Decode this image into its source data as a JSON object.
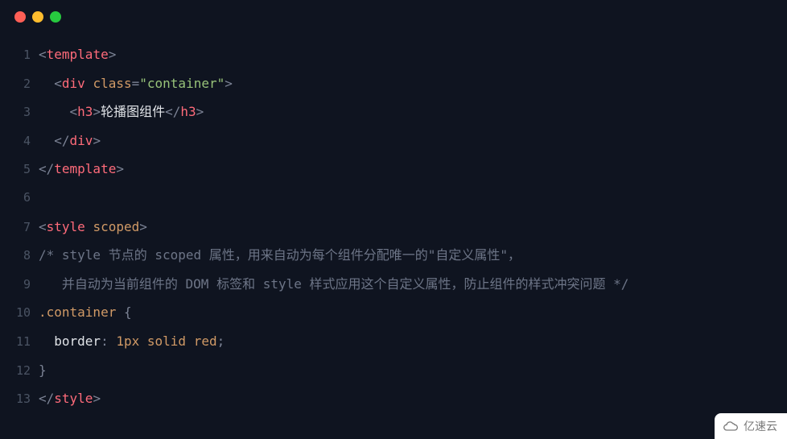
{
  "window": {
    "dots": [
      "red",
      "yellow",
      "green"
    ]
  },
  "code": {
    "lines": [
      {
        "n": 1,
        "tokens": [
          {
            "t": "<",
            "c": "punct"
          },
          {
            "t": "template",
            "c": "tag"
          },
          {
            "t": ">",
            "c": "punct"
          }
        ]
      },
      {
        "n": 2,
        "tokens": [
          {
            "t": "  ",
            "c": "text"
          },
          {
            "t": "<",
            "c": "punct"
          },
          {
            "t": "div",
            "c": "tag"
          },
          {
            "t": " ",
            "c": "text"
          },
          {
            "t": "class",
            "c": "attr"
          },
          {
            "t": "=",
            "c": "punct"
          },
          {
            "t": "\"container\"",
            "c": "string"
          },
          {
            "t": ">",
            "c": "punct"
          }
        ]
      },
      {
        "n": 3,
        "tokens": [
          {
            "t": "    ",
            "c": "text"
          },
          {
            "t": "<",
            "c": "punct"
          },
          {
            "t": "h3",
            "c": "tag"
          },
          {
            "t": ">",
            "c": "punct"
          },
          {
            "t": "轮播图组件",
            "c": "text"
          },
          {
            "t": "</",
            "c": "punct"
          },
          {
            "t": "h3",
            "c": "tag"
          },
          {
            "t": ">",
            "c": "punct"
          }
        ]
      },
      {
        "n": 4,
        "tokens": [
          {
            "t": "  ",
            "c": "text"
          },
          {
            "t": "</",
            "c": "punct"
          },
          {
            "t": "div",
            "c": "tag"
          },
          {
            "t": ">",
            "c": "punct"
          }
        ]
      },
      {
        "n": 5,
        "tokens": [
          {
            "t": "</",
            "c": "punct"
          },
          {
            "t": "template",
            "c": "tag"
          },
          {
            "t": ">",
            "c": "punct"
          }
        ]
      },
      {
        "n": 6,
        "tokens": []
      },
      {
        "n": 7,
        "tokens": [
          {
            "t": "<",
            "c": "punct"
          },
          {
            "t": "style",
            "c": "tag"
          },
          {
            "t": " ",
            "c": "text"
          },
          {
            "t": "scoped",
            "c": "attr"
          },
          {
            "t": ">",
            "c": "punct"
          }
        ]
      },
      {
        "n": 8,
        "tokens": [
          {
            "t": "/* style 节点的 scoped 属性，用来自动为每个组件分配唯一的\"自定义属性\"，",
            "c": "comment"
          }
        ]
      },
      {
        "n": 9,
        "tokens": [
          {
            "t": "   并自动为当前组件的 DOM 标签和 style 样式应用这个自定义属性，防止组件的样式冲突问题 */",
            "c": "comment"
          }
        ]
      },
      {
        "n": 10,
        "tokens": [
          {
            "t": ".container",
            "c": "sel"
          },
          {
            "t": " {",
            "c": "punct"
          }
        ]
      },
      {
        "n": 11,
        "tokens": [
          {
            "t": "  ",
            "c": "text"
          },
          {
            "t": "border",
            "c": "prop"
          },
          {
            "t": ": ",
            "c": "punct"
          },
          {
            "t": "1px",
            "c": "num"
          },
          {
            "t": " ",
            "c": "text"
          },
          {
            "t": "solid",
            "c": "val"
          },
          {
            "t": " ",
            "c": "text"
          },
          {
            "t": "red",
            "c": "val"
          },
          {
            "t": ";",
            "c": "punct"
          }
        ]
      },
      {
        "n": 12,
        "tokens": [
          {
            "t": "}",
            "c": "punct"
          }
        ]
      },
      {
        "n": 13,
        "tokens": [
          {
            "t": "</",
            "c": "punct"
          },
          {
            "t": "style",
            "c": "tag"
          },
          {
            "t": ">",
            "c": "punct"
          }
        ]
      }
    ]
  },
  "watermark": {
    "text": "亿速云"
  }
}
